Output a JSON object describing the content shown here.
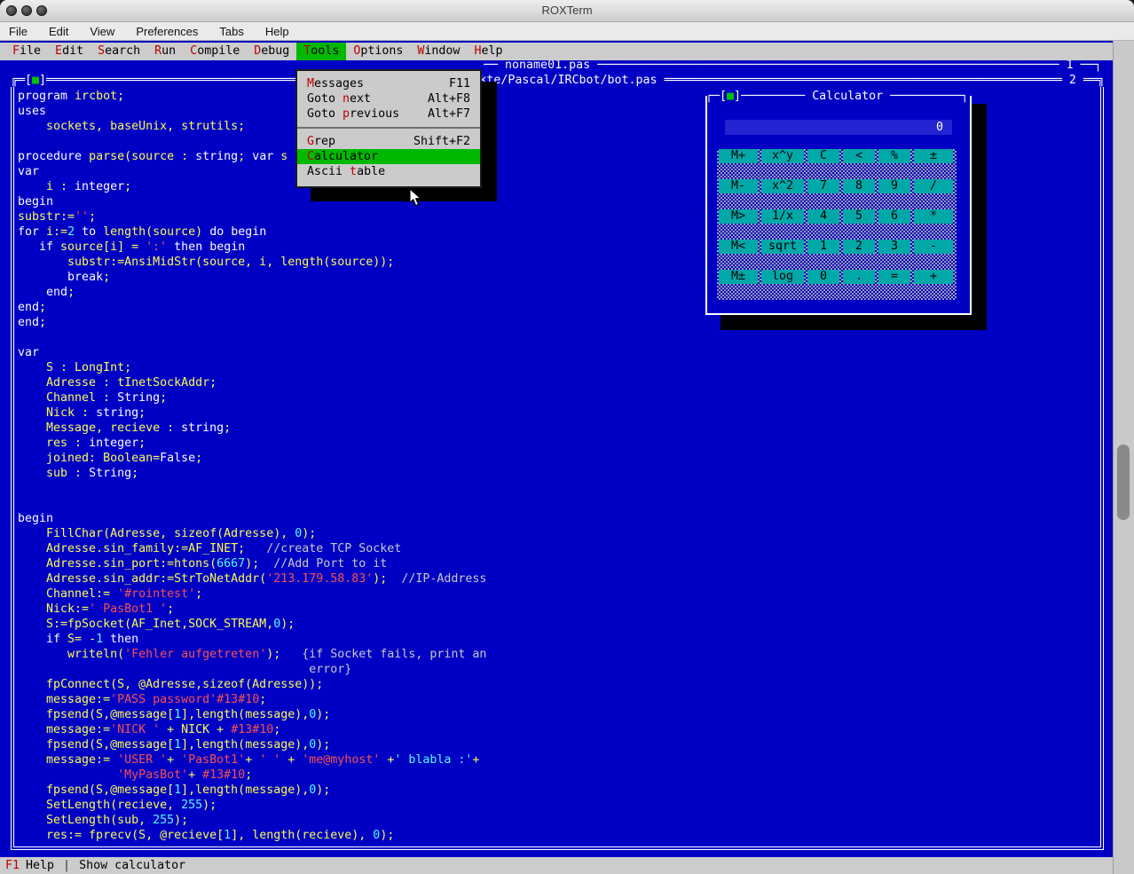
{
  "colors": {
    "terminal_bg": "#0000c4",
    "panel_gray": "#cccccc",
    "highlight_green": "#00b800",
    "close_box_green": "#00c400",
    "button_cyan": "#00a8a8",
    "hotkey_red": "#bb0000",
    "code_white": "#fcfcfc",
    "code_yellow": "#fcfc54",
    "code_string_red": "#f85050",
    "code_number_cyan": "#54fcfc",
    "code_comment_gray": "#c8c8c8"
  },
  "mac": {
    "window_title": "ROXTerm",
    "menu_items": [
      "File",
      "Edit",
      "View",
      "Preferences",
      "Tabs",
      "Help"
    ]
  },
  "ide_menubar": {
    "items": [
      {
        "label": "File",
        "hot": 0
      },
      {
        "label": "Edit",
        "hot": 0
      },
      {
        "label": "Search",
        "hot": 0
      },
      {
        "label": "Run",
        "hot": 0
      },
      {
        "label": "Compile",
        "hot": 0
      },
      {
        "label": "Debug",
        "hot": 0
      },
      {
        "label": "Tools",
        "hot": 0,
        "active": true
      },
      {
        "label": "Options",
        "hot": 0
      },
      {
        "label": "Window",
        "hot": 0
      },
      {
        "label": "Help",
        "hot": 0
      }
    ]
  },
  "tools_menu": {
    "items": [
      {
        "label": "Messages",
        "hot": 0,
        "shortcut": "F11"
      },
      {
        "label": "Goto next",
        "hot": 5,
        "shortcut": "Alt+F8"
      },
      {
        "label": "Goto previous",
        "hot": 5,
        "shortcut": "Alt+F7"
      },
      {
        "separator": true
      },
      {
        "label": "Grep",
        "hot": 0,
        "shortcut": "Shift+F2"
      },
      {
        "label": "Calculator",
        "hot": 0,
        "selected": true,
        "shortcut": ""
      },
      {
        "label": "Ascii table",
        "hot": 6,
        "shortcut": ""
      }
    ]
  },
  "editor_windows": {
    "window1": {
      "title": "noname01.pas",
      "number": "1"
    },
    "window2": {
      "title": "kte/Pascal/IRCbot/bot.pas",
      "number": "2"
    }
  },
  "calculator": {
    "title": "Calculator",
    "display": "0",
    "buttons": [
      [
        "M+",
        "x^y",
        "C",
        "<",
        "%",
        "±"
      ],
      [
        "M-",
        "x^2",
        "7",
        "8",
        "9",
        "/"
      ],
      [
        "M>",
        "1/x",
        "4",
        "5",
        "6",
        "*"
      ],
      [
        "M<",
        "sqrt",
        "1",
        "2",
        "3",
        "-"
      ],
      [
        "M±",
        "log",
        "0",
        ".",
        "=",
        "+"
      ]
    ]
  },
  "statusbar": {
    "f1": "F1",
    "help": "Help",
    "separator": "|",
    "hint": "Show calculator"
  },
  "code_lines": [
    [
      [
        "w",
        "program"
      ],
      [
        "y",
        " ircbot;"
      ]
    ],
    [
      [
        "w",
        "uses"
      ]
    ],
    [
      [
        "y",
        "    sockets, baseUnix, strutils;"
      ]
    ],
    [],
    [
      [
        "w",
        "procedure"
      ],
      [
        "y",
        " parse(source : "
      ],
      [
        "w",
        "string"
      ],
      [
        "y",
        "; "
      ],
      [
        "w",
        "var"
      ],
      [
        "y",
        " s"
      ]
    ],
    [
      [
        "w",
        "var"
      ]
    ],
    [
      [
        "y",
        "    i : "
      ],
      [
        "w",
        "integer"
      ],
      [
        "y",
        ";"
      ]
    ],
    [
      [
        "w",
        "begin"
      ]
    ],
    [
      [
        "y",
        "substr:="
      ],
      [
        "r",
        "''"
      ],
      [
        "y",
        ";"
      ]
    ],
    [
      [
        "w",
        "for"
      ],
      [
        "y",
        " i:="
      ],
      [
        "c",
        "2"
      ],
      [
        "y",
        " "
      ],
      [
        "w",
        "to"
      ],
      [
        "y",
        " length(source) "
      ],
      [
        "w",
        "do"
      ],
      [
        "y",
        " "
      ],
      [
        "w",
        "begin"
      ]
    ],
    [
      [
        "y",
        "   "
      ],
      [
        "w",
        "if"
      ],
      [
        "y",
        " source[i] = "
      ],
      [
        "r",
        "':'"
      ],
      [
        "y",
        " "
      ],
      [
        "w",
        "then"
      ],
      [
        "y",
        " "
      ],
      [
        "w",
        "begin"
      ]
    ],
    [
      [
        "y",
        "       substr:=AnsiMidStr(source, i, length(source));"
      ]
    ],
    [
      [
        "y",
        "       "
      ],
      [
        "w",
        "break"
      ],
      [
        "y",
        ";"
      ]
    ],
    [
      [
        "y",
        "    "
      ],
      [
        "w",
        "end"
      ],
      [
        "y",
        ";"
      ]
    ],
    [
      [
        "w",
        "end"
      ],
      [
        "y",
        ";"
      ]
    ],
    [
      [
        "w",
        "end"
      ],
      [
        "y",
        ";"
      ]
    ],
    [],
    [
      [
        "w",
        "var"
      ]
    ],
    [
      [
        "y",
        "    S : LongInt;"
      ]
    ],
    [
      [
        "y",
        "    Adresse : tInetSockAddr;"
      ]
    ],
    [
      [
        "y",
        "    Channel : "
      ],
      [
        "w",
        "String"
      ],
      [
        "y",
        ";"
      ]
    ],
    [
      [
        "y",
        "    Nick : "
      ],
      [
        "w",
        "string"
      ],
      [
        "y",
        ";"
      ]
    ],
    [
      [
        "y",
        "    Message, recieve : "
      ],
      [
        "w",
        "string"
      ],
      [
        "y",
        ";"
      ]
    ],
    [
      [
        "y",
        "    res : "
      ],
      [
        "w",
        "integer"
      ],
      [
        "y",
        ";"
      ]
    ],
    [
      [
        "y",
        "    joined: Boolean="
      ],
      [
        "w",
        "False"
      ],
      [
        "y",
        ";"
      ]
    ],
    [
      [
        "y",
        "    sub : "
      ],
      [
        "w",
        "String"
      ],
      [
        "y",
        ";"
      ]
    ],
    [],
    [],
    [
      [
        "w",
        "begin"
      ]
    ],
    [
      [
        "y",
        "    FillChar(Adresse, sizeof(Adresse), "
      ],
      [
        "c",
        "0"
      ],
      [
        "y",
        ");"
      ]
    ],
    [
      [
        "y",
        "    Adresse.sin_family:=AF_INET;   "
      ],
      [
        "g",
        "//create TCP Socket"
      ]
    ],
    [
      [
        "y",
        "    Adresse.sin_port:=htons("
      ],
      [
        "c",
        "6667"
      ],
      [
        "y",
        ");  "
      ],
      [
        "g",
        "//Add Port to it"
      ]
    ],
    [
      [
        "y",
        "    Adresse.sin_addr:=StrToNetAddr("
      ],
      [
        "r",
        "'213.179.58.83'"
      ],
      [
        "y",
        ");  "
      ],
      [
        "g",
        "//IP-Address"
      ]
    ],
    [
      [
        "y",
        "    Channel:= "
      ],
      [
        "r",
        "'#rointest'"
      ],
      [
        "y",
        ";"
      ]
    ],
    [
      [
        "y",
        "    Nick:="
      ],
      [
        "r",
        "' PasBot1 '"
      ],
      [
        "y",
        ";"
      ]
    ],
    [
      [
        "y",
        "    S:=fpSocket(AF_Inet,SOCK_STREAM,"
      ],
      [
        "c",
        "0"
      ],
      [
        "y",
        ");"
      ]
    ],
    [
      [
        "y",
        "    "
      ],
      [
        "w",
        "if"
      ],
      [
        "y",
        " S= -"
      ],
      [
        "c",
        "1"
      ],
      [
        "y",
        " "
      ],
      [
        "w",
        "then"
      ]
    ],
    [
      [
        "y",
        "       writeln("
      ],
      [
        "r",
        "'Fehler aufgetreten'"
      ],
      [
        "y",
        ");   "
      ],
      [
        "g",
        "{if Socket fails, print an"
      ]
    ],
    [
      [
        "g",
        "                                         error}"
      ]
    ],
    [
      [
        "y",
        "    fpConnect(S, @Adresse,sizeof(Adresse));"
      ]
    ],
    [
      [
        "y",
        "    message:="
      ],
      [
        "r",
        "'PASS password'"
      ],
      [
        "r",
        "#13#10"
      ],
      [
        "y",
        ";"
      ]
    ],
    [
      [
        "y",
        "    fpsend(S,@message["
      ],
      [
        "c",
        "1"
      ],
      [
        "y",
        "],length(message),"
      ],
      [
        "c",
        "0"
      ],
      [
        "y",
        ");"
      ]
    ],
    [
      [
        "y",
        "    message:="
      ],
      [
        "r",
        "'NICK '"
      ],
      [
        "y",
        " + NICK + "
      ],
      [
        "r",
        "#13#10"
      ],
      [
        "y",
        ";"
      ]
    ],
    [
      [
        "y",
        "    fpsend(S,@message["
      ],
      [
        "c",
        "1"
      ],
      [
        "y",
        "],length(message),"
      ],
      [
        "c",
        "0"
      ],
      [
        "y",
        ");"
      ]
    ],
    [
      [
        "y",
        "    message:= "
      ],
      [
        "r",
        "'USER '"
      ],
      [
        "y",
        "+ "
      ],
      [
        "r",
        "'PasBot1'"
      ],
      [
        "y",
        "+ "
      ],
      [
        "r",
        "' '"
      ],
      [
        "y",
        " + "
      ],
      [
        "r",
        "'me@myhost'"
      ],
      [
        "y",
        " +"
      ],
      [
        "c",
        "' blabla :'"
      ],
      [
        "y",
        "+"
      ]
    ],
    [
      [
        "y",
        "              "
      ],
      [
        "r",
        "'MyPasBot'"
      ],
      [
        "y",
        "+ "
      ],
      [
        "r",
        "#13#10"
      ],
      [
        "y",
        ";"
      ]
    ],
    [
      [
        "y",
        "    fpsend(S,@message["
      ],
      [
        "c",
        "1"
      ],
      [
        "y",
        "],length(message),"
      ],
      [
        "c",
        "0"
      ],
      [
        "y",
        ");"
      ]
    ],
    [
      [
        "y",
        "    SetLength(recieve, "
      ],
      [
        "c",
        "255"
      ],
      [
        "y",
        ");"
      ]
    ],
    [
      [
        "y",
        "    SetLength(sub, "
      ],
      [
        "c",
        "255"
      ],
      [
        "y",
        ");"
      ]
    ],
    [
      [
        "y",
        "    res:= fprecv(S, @recieve["
      ],
      [
        "c",
        "1"
      ],
      [
        "y",
        "], length(recieve), "
      ],
      [
        "c",
        "0"
      ],
      [
        "y",
        ");"
      ]
    ]
  ]
}
